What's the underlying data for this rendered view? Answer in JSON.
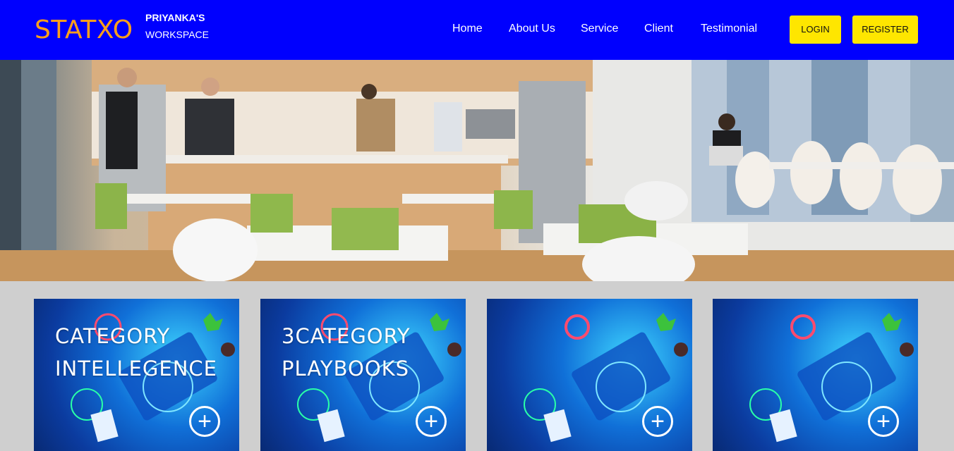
{
  "header": {
    "logo": "STATXO",
    "workspace_line1": "PRIYANKA'S",
    "workspace_line2": "WORKSPACE",
    "nav": [
      "Home",
      "About Us",
      "Service",
      "Client",
      "Testimonial"
    ],
    "login": "LOGIN",
    "register": "REGISTER",
    "colors": {
      "bar": "#0000fe",
      "logo": "#ff9f1a",
      "button": "#fee600"
    }
  },
  "hero": {
    "description_icon": "office-kitchen-photo"
  },
  "cards": [
    {
      "line1": "CATEGORY",
      "line2": "INTELLEGENCE",
      "icon": "plus-circle-icon"
    },
    {
      "line1": "3CATEGORY",
      "line2": "PLAYBOOKS",
      "icon": "plus-circle-icon"
    },
    {
      "line1": "",
      "line2": "",
      "icon": "plus-circle-icon"
    },
    {
      "line1": "",
      "line2": "",
      "icon": "plus-circle-icon"
    }
  ]
}
